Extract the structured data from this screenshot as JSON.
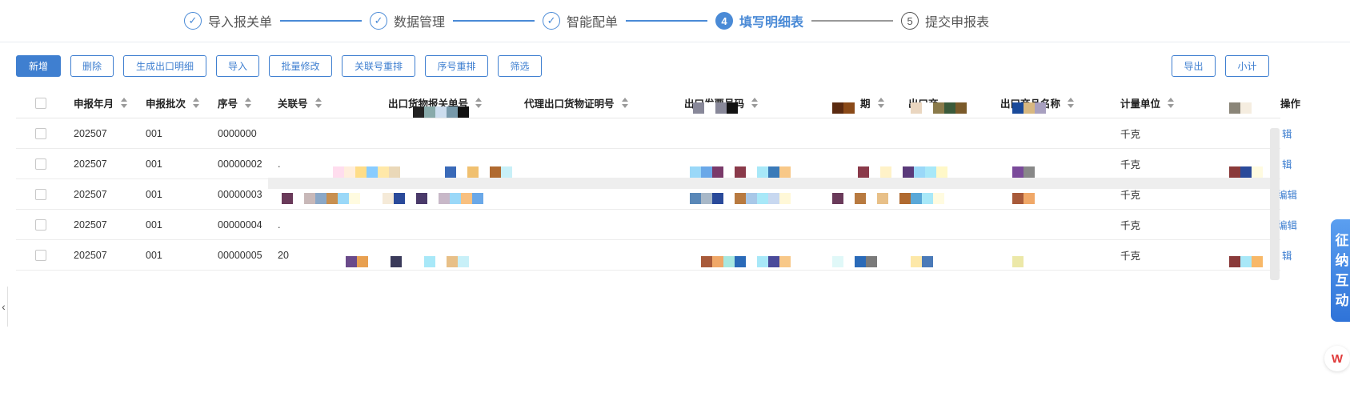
{
  "steps": [
    {
      "num": "✓",
      "label": "导入报关单",
      "state": "done"
    },
    {
      "num": "✓",
      "label": "数据管理",
      "state": "done"
    },
    {
      "num": "✓",
      "label": "智能配单",
      "state": "done"
    },
    {
      "num": "4",
      "label": "填写明细表",
      "state": "active"
    },
    {
      "num": "5",
      "label": "提交申报表",
      "state": "pending"
    }
  ],
  "toolbar": {
    "add": "新增",
    "delete": "删除",
    "generate": "生成出口明细",
    "import": "导入",
    "batch_edit": "批量修改",
    "reorder_link": "关联号重排",
    "reorder_seq": "序号重排",
    "filter": "筛选",
    "export": "导出",
    "subtotal": "小计"
  },
  "table": {
    "headers": {
      "period": "申报年月",
      "batch": "申报批次",
      "seq": "序号",
      "link_no": "关联号",
      "customs_no": "出口货物报关单号",
      "agent_cert": "代理出口货物证明号",
      "invoice_no": "出口发票号码",
      "date": "期",
      "product": "出口商",
      "product_name": "出口商品名称",
      "unit": "计量单位",
      "action": "操作"
    },
    "rows": [
      {
        "period": "202507",
        "batch": "001",
        "seq": "0000000",
        "link": "",
        "unit": "千克",
        "action": "辑"
      },
      {
        "period": "202507",
        "batch": "001",
        "seq": "00000002",
        "link": ".",
        "unit": "千克",
        "action": "辑"
      },
      {
        "period": "202507",
        "batch": "001",
        "seq": "00000003",
        "link": "",
        "unit": "千克",
        "action": "编辑"
      },
      {
        "period": "202507",
        "batch": "001",
        "seq": "00000004",
        "link": ".",
        "unit": "千克",
        "action": "编辑"
      },
      {
        "period": "202507",
        "batch": "001",
        "seq": "00000005",
        "link": "20",
        "unit": "千克",
        "action": "辑"
      }
    ]
  },
  "side": {
    "left_arrow": "‹",
    "float_tab": [
      "征",
      "纳",
      "互",
      "动"
    ],
    "wps": "W"
  },
  "colors": {
    "accent": "#3f7fd0"
  }
}
